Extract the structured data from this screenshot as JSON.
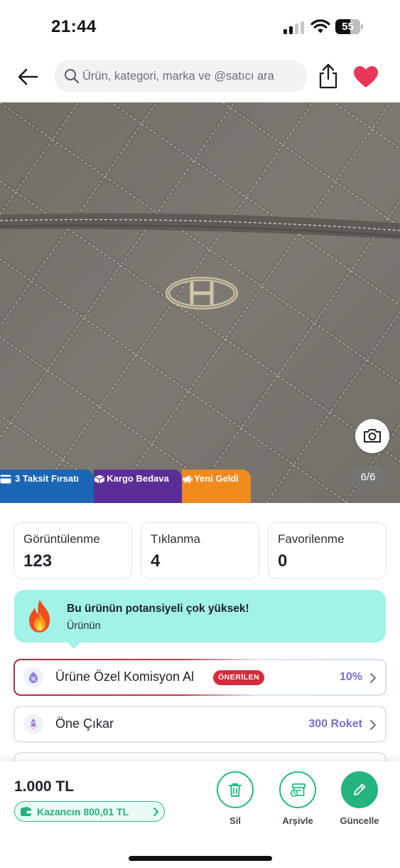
{
  "status_bar": {
    "time": "21:44",
    "battery_level": "55",
    "icons": [
      "signal-icon",
      "wifi-icon",
      "battery-icon"
    ]
  },
  "header": {
    "search_placeholder": "Ürün, kategori, marka ve @satıcı ara",
    "icons": [
      "back-arrow-icon",
      "search-icon",
      "share-icon",
      "heart-icon"
    ],
    "favorite_color": "#e8375a"
  },
  "product_image": {
    "counter": "6/6",
    "badges": [
      {
        "label": "3 Taksit Fırsatı",
        "icon": "card-icon",
        "color": "#1a66b5"
      },
      {
        "label": "Kargo Bedava",
        "icon": "box-icon",
        "color": "#5b2d96"
      },
      {
        "label": "Yeni Geldi",
        "icon": "megaphone-icon",
        "color": "#f08a1c"
      }
    ]
  },
  "stats": [
    {
      "label": "Görüntülenme",
      "value": "123"
    },
    {
      "label": "Tıklanma",
      "value": "4"
    },
    {
      "label": "Favorilenme",
      "value": "0"
    }
  ],
  "potential": {
    "title": "Bu ürünün potansiyeli çok yüksek!",
    "subtitle": "Ürünün",
    "icon": "fire-icon",
    "color": "#a2f2e6"
  },
  "actions": [
    {
      "label": "Ürüne Özel Komisyon Al",
      "tag": "ÖNERİLEN",
      "value": "10%",
      "icon": "commission-icon"
    },
    {
      "label": "Öne Çıkar",
      "value": "300 Roket",
      "icon": "rocket-icon"
    }
  ],
  "bottom_bar": {
    "price": "1.000 TL",
    "earnings": "Kazancın 800,01 TL",
    "buttons": [
      {
        "label": "Sil",
        "icon": "trash-icon"
      },
      {
        "label": "Arşivle",
        "icon": "archive-icon"
      },
      {
        "label": "Güncelle",
        "icon": "pencil-icon"
      }
    ],
    "accent_color": "#23b47f"
  }
}
